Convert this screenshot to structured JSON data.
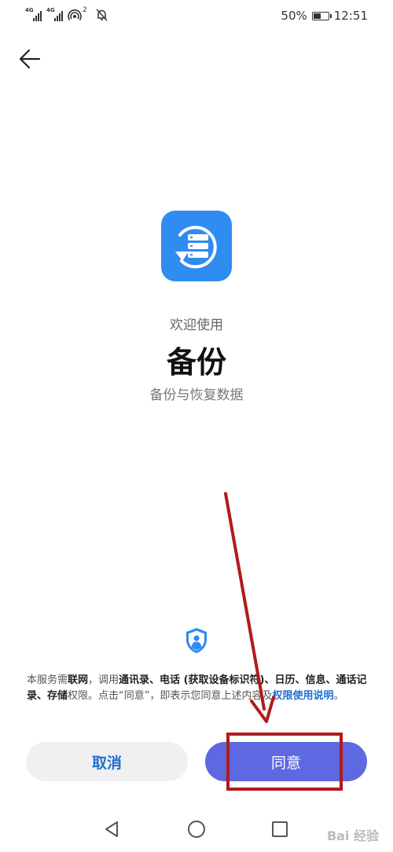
{
  "status_bar": {
    "signal1": "4G",
    "signal2": "4G",
    "hotspot_count": "2",
    "battery_percent": "50%",
    "battery_level": 0.5,
    "time": "12:51"
  },
  "main": {
    "welcome": "欢迎使用",
    "app_name": "备份",
    "subtitle": "备份与恢复数据",
    "app_icon": "backup-restore-icon",
    "accent_color": "#2f8cf0"
  },
  "notice": {
    "p1": "本服务需",
    "b1": "联网",
    "p2": "，调用",
    "b2": "通讯录、电话 (获取设备标识符)、日历、信息、通话记录、存储",
    "p3": "权限。点击“同意”，即表示您同意上述内容及",
    "link": "权限使用说明",
    "p4": "。"
  },
  "buttons": {
    "cancel": "取消",
    "agree": "同意",
    "agree_color": "#5e68e0"
  },
  "watermark": "Bai 经验"
}
